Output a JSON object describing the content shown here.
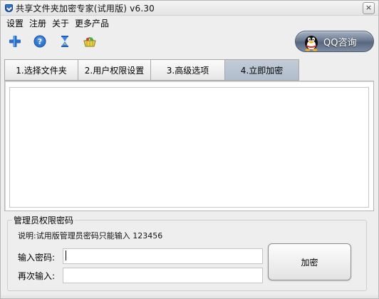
{
  "window": {
    "title": "共享文件夹加密专家(试用版) v6.30",
    "close_glyph": "×"
  },
  "menu": [
    {
      "label": "设置"
    },
    {
      "label": "注册"
    },
    {
      "label": "关于"
    },
    {
      "label": "更多产品"
    }
  ],
  "toolbar": [
    {
      "icon": "plus-icon"
    },
    {
      "icon": "help-icon"
    },
    {
      "icon": "hourglass-icon"
    },
    {
      "icon": "basket-icon"
    }
  ],
  "qq_button": {
    "label": "QQ咨询",
    "icon": "qq-penguin-icon"
  },
  "tabs": [
    {
      "label": "1.选择文件夹",
      "active": false
    },
    {
      "label": "2.用户权限设置",
      "active": false
    },
    {
      "label": "3.高级选项",
      "active": false
    },
    {
      "label": "4.立即加密",
      "active": true
    }
  ],
  "password_group": {
    "legend": "管理员权限密码",
    "note": "说明:试用版管理员密码只能输入  123456",
    "enter_label": "输入密码:",
    "enter_value": "",
    "repeat_label": "再次输入:",
    "repeat_value": "",
    "encrypt_button": "加密"
  },
  "colors": {
    "tab_active": "#b9c4d3",
    "qq_button": "#6b7a92",
    "accent_blue": "#2a6cc8"
  }
}
